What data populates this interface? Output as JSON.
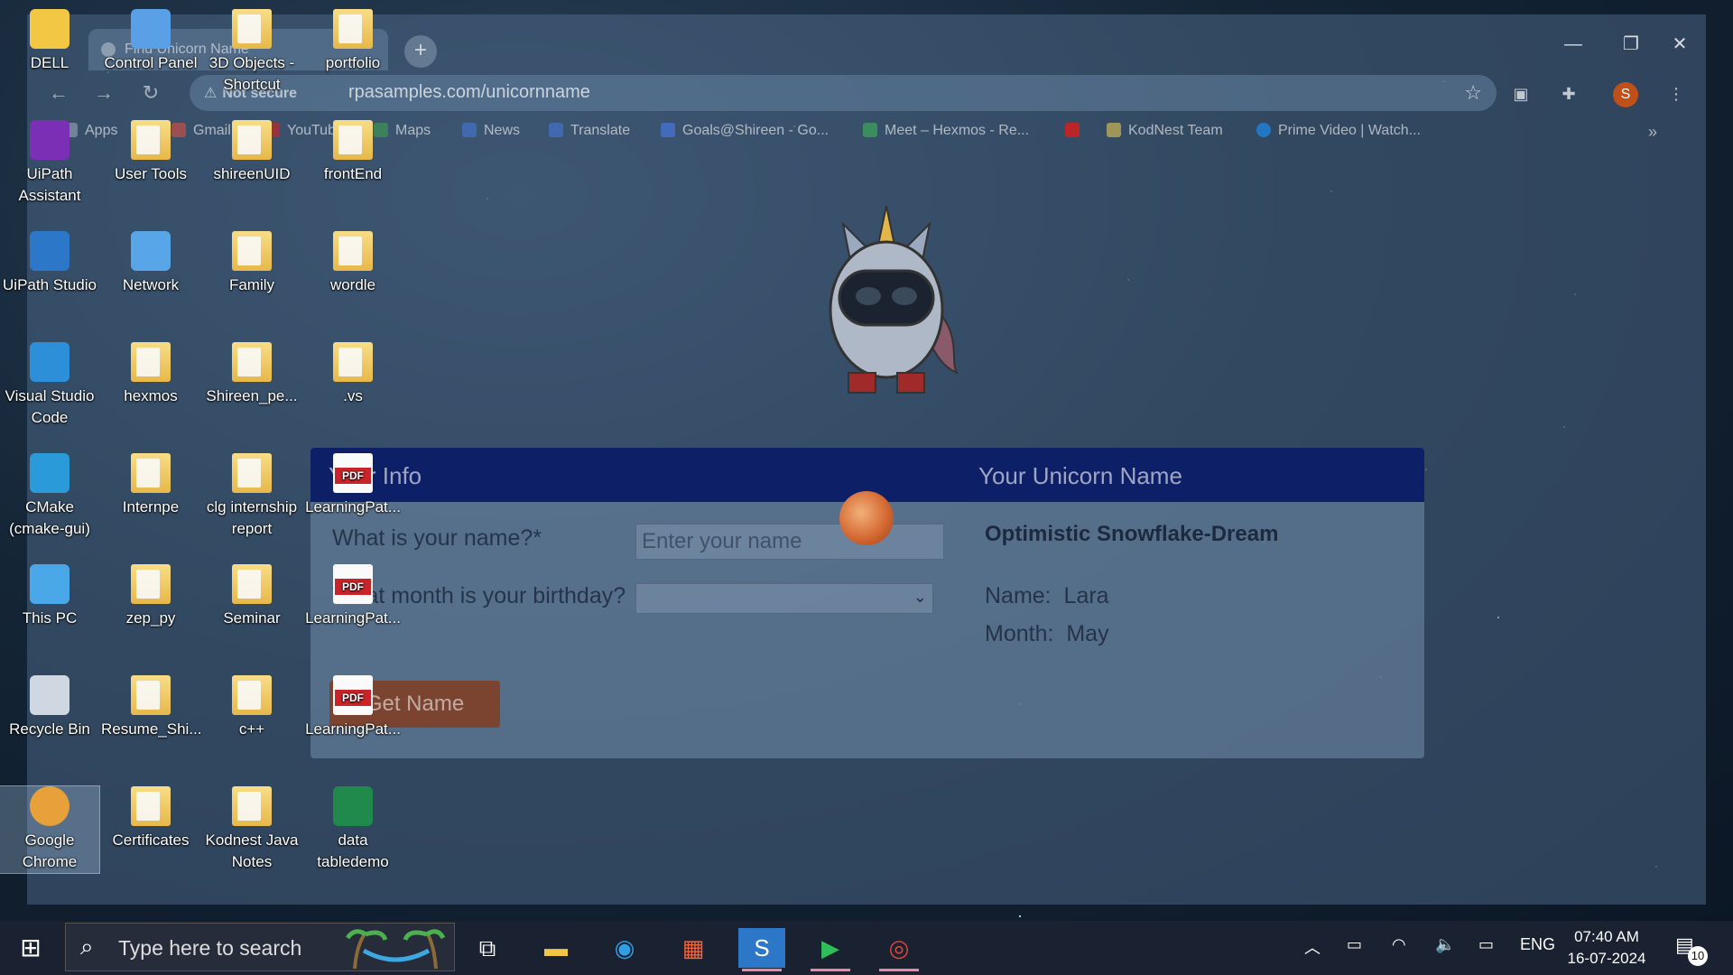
{
  "browser": {
    "tab_title": "Find Unicorn Name",
    "url": "rpasamples.com/unicornname",
    "security_label": "Not secure",
    "profile_initial": "S",
    "bookmarks": [
      "Apps",
      "Gmail",
      "YouTube",
      "Maps",
      "News",
      "Translate",
      "Goals@Shireen - Go...",
      "Meet – Hexmos - Re...",
      "KodNest Team",
      "Prime Video | Watch..."
    ]
  },
  "form": {
    "left_header": "Your Info",
    "right_header": "Your Unicorn Name",
    "name_label": "What is your name?*",
    "name_placeholder": "Enter your name",
    "month_label": "What month is your birthday?",
    "month_value": "",
    "button_label": "Get Name",
    "unicorn_name": "Optimistic Snowflake-Dream",
    "result_name_label": "Name:",
    "result_name_value": "Lara",
    "result_month_label": "Month:",
    "result_month_value": "May"
  },
  "desktop": {
    "icons": [
      {
        "label": "DELL",
        "icon": "user-folder-icon"
      },
      {
        "label": "Control Panel",
        "icon": "control-panel-icon"
      },
      {
        "label": "3D Objects - Shortcut",
        "icon": "folder-icon"
      },
      {
        "label": "portfolio",
        "icon": "folder-icon"
      },
      {
        "label": "UiPath Assistant",
        "icon": "uipath-assistant-icon"
      },
      {
        "label": "User Tools",
        "icon": "folder-icon"
      },
      {
        "label": "shireenUID",
        "icon": "folder-icon"
      },
      {
        "label": "frontEnd",
        "icon": "folder-icon"
      },
      {
        "label": "UiPath Studio",
        "icon": "uipath-studio-icon"
      },
      {
        "label": "Network",
        "icon": "network-icon"
      },
      {
        "label": "Family",
        "icon": "folder-icon"
      },
      {
        "label": "wordle",
        "icon": "folder-icon"
      },
      {
        "label": "Visual Studio Code",
        "icon": "vscode-icon"
      },
      {
        "label": "hexmos",
        "icon": "folder-icon"
      },
      {
        "label": "Shireen_pe...",
        "icon": "folder-icon"
      },
      {
        "label": ".vs",
        "icon": "folder-icon"
      },
      {
        "label": "CMake (cmake-gui)",
        "icon": "cmake-icon"
      },
      {
        "label": "Internpe",
        "icon": "folder-icon"
      },
      {
        "label": "clg internship report",
        "icon": "folder-icon"
      },
      {
        "label": "LearningPat...",
        "icon": "pdf-icon"
      },
      {
        "label": "This PC",
        "icon": "computer-icon"
      },
      {
        "label": "zep_py",
        "icon": "folder-icon"
      },
      {
        "label": "Seminar",
        "icon": "folder-icon"
      },
      {
        "label": "LearningPat...",
        "icon": "pdf-icon"
      },
      {
        "label": "Recycle Bin",
        "icon": "recycle-bin-icon"
      },
      {
        "label": "Resume_Shi...",
        "icon": "folder-icon"
      },
      {
        "label": "c++",
        "icon": "folder-icon"
      },
      {
        "label": "LearningPat...",
        "icon": "pdf-icon"
      },
      {
        "label": "Google Chrome",
        "icon": "chrome-icon"
      },
      {
        "label": "Certificates",
        "icon": "folder-icon"
      },
      {
        "label": "Kodnest Java Notes",
        "icon": "folder-icon"
      },
      {
        "label": "data tabledemo",
        "icon": "excel-icon"
      }
    ]
  },
  "taskbar": {
    "search_placeholder": "Type here to search",
    "language": "ENG",
    "time": "07:40 AM",
    "date": "16-07-2024",
    "notification_count": "10"
  },
  "colors": {
    "card_header": "#0d1f66",
    "button": "#8c320a",
    "taskbar": "#1a2130"
  }
}
